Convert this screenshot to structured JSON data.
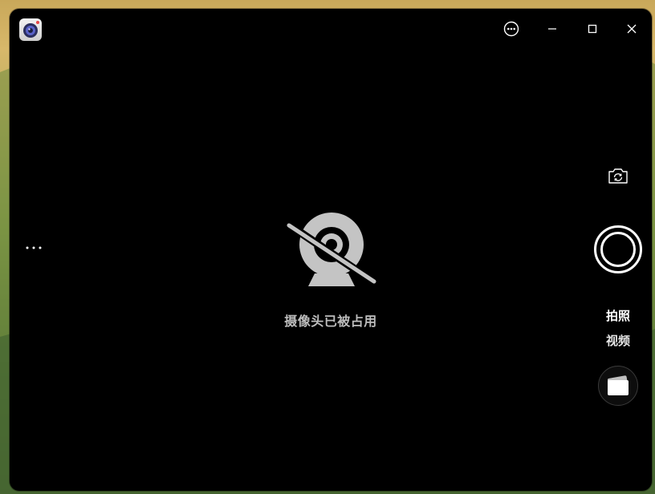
{
  "window": {
    "title_icon": "camera-app-icon"
  },
  "titlebar": {
    "buttons": [
      "more-options-icon",
      "minimize-icon",
      "maximize-icon",
      "close-icon"
    ]
  },
  "viewfinder": {
    "status_icon": "camera-disabled-icon",
    "status_text": "摄像头已被占用"
  },
  "side_menu": {
    "icon": "ellipsis-icon"
  },
  "controls": {
    "switch_camera_icon": "switch-camera-icon",
    "shutter_icon": "shutter-icon",
    "modes": [
      {
        "label": "拍照",
        "active": true
      },
      {
        "label": "视频",
        "active": false
      }
    ],
    "gallery_icon": "gallery-thumbnail-icon"
  },
  "colors": {
    "window_bg": "#000000",
    "status_text": "#bdbdbd",
    "status_icon": "#c4c4c4",
    "control_fg": "#ffffff"
  }
}
